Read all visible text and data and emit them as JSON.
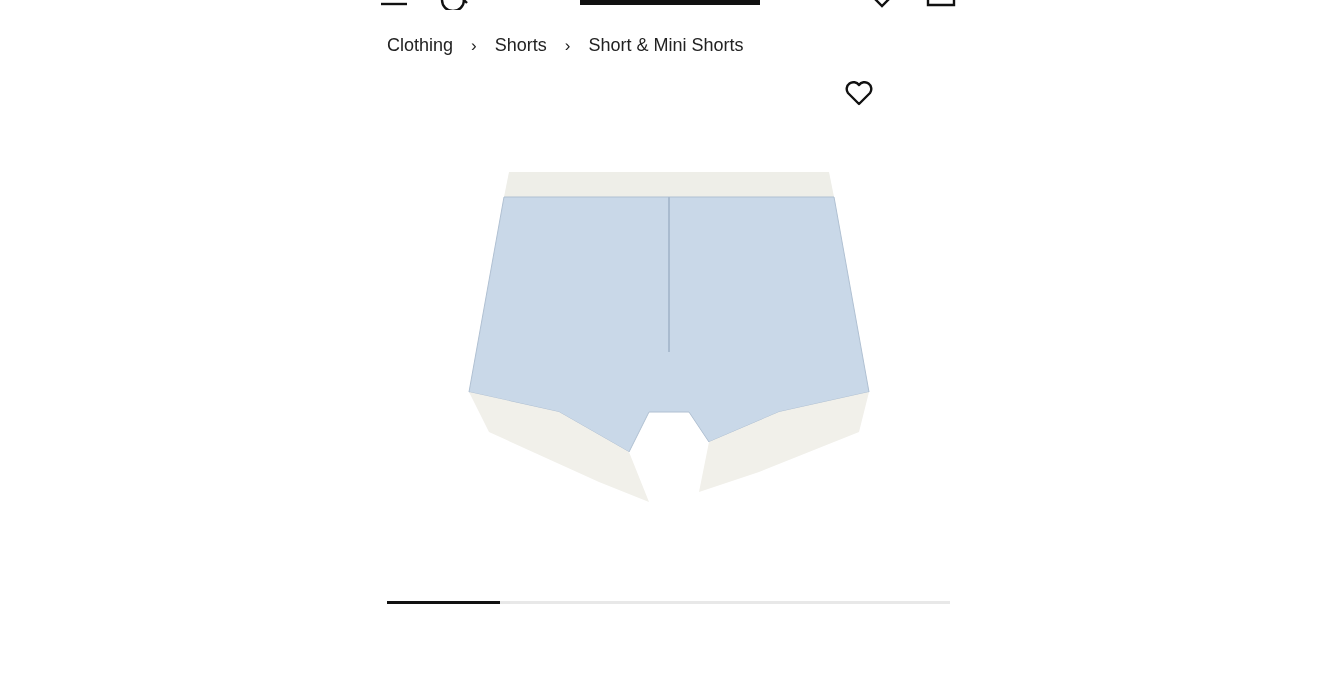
{
  "breadcrumb": [
    {
      "label": "Clothing"
    },
    {
      "label": "Shorts"
    },
    {
      "label": "Short & Mini Shorts"
    }
  ],
  "breadcrumb_separator": "›",
  "wishlist": {
    "saved": false
  },
  "gallery": {
    "level": 0.2
  }
}
